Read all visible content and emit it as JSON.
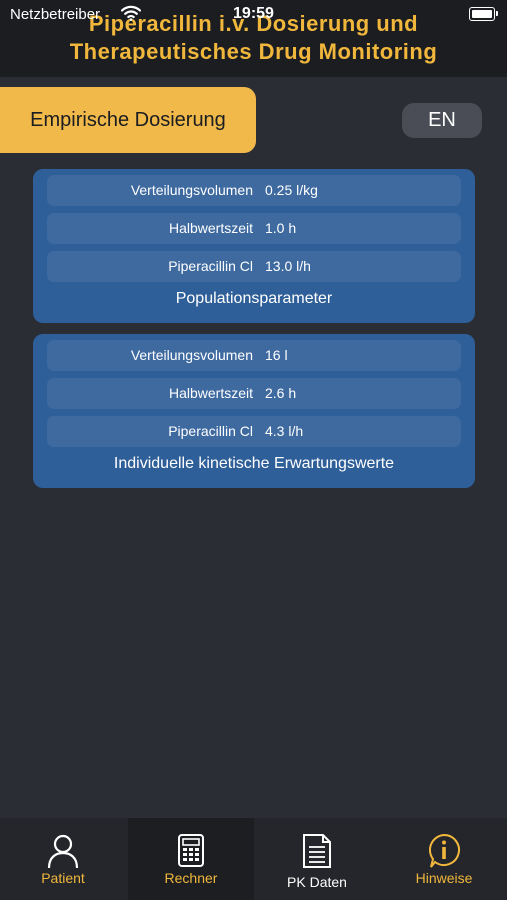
{
  "status_bar": {
    "carrier": "Netzbetreiber",
    "time": "19:59"
  },
  "header": {
    "title_line1": "Piperacillin i.v. Dosierung und",
    "title_line2": "Therapeutisches Drug Monitoring"
  },
  "controls": {
    "mode_label": "Empirische Dosierung",
    "language_label": "EN"
  },
  "population_card": {
    "title": "Populationsparameter",
    "rows": [
      {
        "label": "Verteilungsvolumen",
        "value": "0.25 l/kg"
      },
      {
        "label": "Halbwertszeit",
        "value": "1.0 h"
      },
      {
        "label": "Piperacillin Cl",
        "value": "13.0 l/h"
      }
    ]
  },
  "individual_card": {
    "title": "Individuelle kinetische Erwartungswerte",
    "rows": [
      {
        "label": "Verteilungsvolumen",
        "value": "16 l"
      },
      {
        "label": "Halbwertszeit",
        "value": "2.6 h"
      },
      {
        "label": "Piperacillin Cl",
        "value": "4.3 l/h"
      }
    ]
  },
  "tabbar": {
    "tabs": [
      {
        "label": "Patient",
        "icon": "person-icon"
      },
      {
        "label": "Rechner",
        "icon": "calculator-icon"
      },
      {
        "label": "PK Daten",
        "icon": "document-icon"
      },
      {
        "label": "Hinweise",
        "icon": "info-icon"
      }
    ],
    "active_tab": "Rechner"
  },
  "colors": {
    "accent": "#f0b73c",
    "card": "#2f5f98",
    "background": "#2a2d33"
  }
}
